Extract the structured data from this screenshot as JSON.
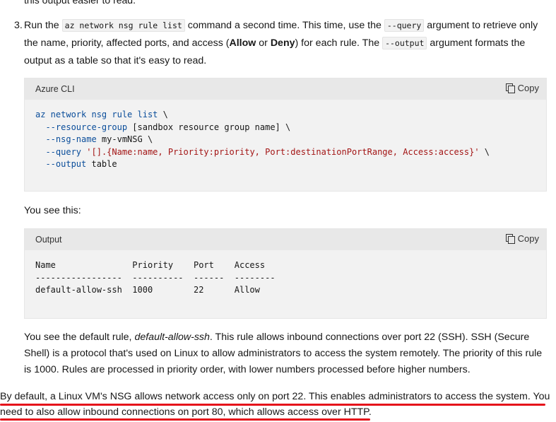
{
  "top_fragment": "this output easier to read.",
  "step": {
    "number": "3.",
    "t1": "Run the ",
    "c1": "az network nsg rule list",
    "t2": " command a second time. This time, use the ",
    "c2": "--query",
    "t3": " argument to retrieve only the name, priority, affected ports, and access (",
    "b1": "Allow",
    "t4": " or ",
    "b2": "Deny",
    "t5": ") for each rule. The ",
    "c3": "--output",
    "t6": " argument formats the output as a table so that it's easy to read."
  },
  "cli_block": {
    "language": "Azure CLI",
    "copy_label": "Copy",
    "lines": [
      {
        "a": "az network nsg rule list",
        "b": " \\",
        "c": ""
      },
      {
        "a": "  --resource-group",
        "b": " [sandbox resource group name] \\",
        "c": ""
      },
      {
        "a": "  --nsg-name",
        "b": " my-vmNSG \\",
        "c": ""
      },
      {
        "a": "  --query",
        "b": " ",
        "c": "'[].{Name:name, Priority:priority, Port:destinationPortRange, Access:access}'",
        "d": " \\"
      },
      {
        "a": "  --output",
        "b": " table",
        "c": ""
      }
    ]
  },
  "see_this": "You see this:",
  "output_block": {
    "language": "Output",
    "copy_label": "Copy",
    "lines": [
      "Name               Priority    Port    Access",
      "-----------------  ----------  ------  --------",
      "default-allow-ssh  1000        22      Allow"
    ]
  },
  "default_rule": {
    "t1": "You see the default rule, ",
    "em": "default-allow-ssh",
    "t2": ". This rule allows inbound connections over port 22 (SSH). SSH (Secure Shell) is a protocol that's used on Linux to allow administrators to access the system remotely. The priority of this rule is 1000. Rules are processed in priority order, with lower numbers processed before higher numbers."
  },
  "highlight": {
    "line1": "By default, a Linux VM's NSG allows network access only on port 22. This enables administrators to access the system. You",
    "line2": "need to also allow inbound connections on port 80, which allows access over HTTP.",
    "underline_color": "#e5121b"
  }
}
